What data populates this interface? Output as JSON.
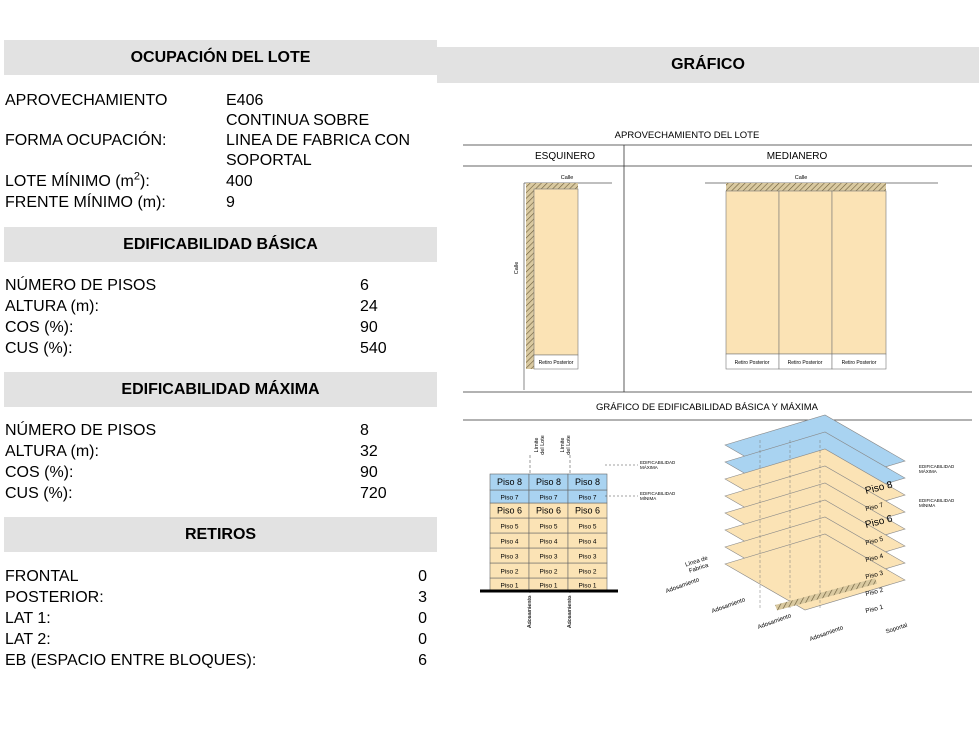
{
  "ocupacion": {
    "title": "OCUPACIÓN DEL LOTE",
    "aprovechamiento_label": "APROVECHAMIENTO",
    "aprovechamiento_value": "E406",
    "forma_label": "FORMA OCUPACIÓN:",
    "forma_value_1": "CONTINUA SOBRE",
    "forma_value_2": "LINEA DE FABRICA CON",
    "forma_value_3": "SOPORTAL",
    "lote_label": "LOTE MÍNIMO (m",
    "lote_sup": "2",
    "lote_label_end": "):",
    "lote_value": "400",
    "frente_label": "FRENTE MÍNIMO (m):",
    "frente_value": "9"
  },
  "basica": {
    "title": "EDIFICABILIDAD BÁSICA",
    "rows": [
      {
        "label": "NÚMERO DE PISOS",
        "value": "6"
      },
      {
        "label": "ALTURA (m):",
        "value": "24"
      },
      {
        "label": "COS (%):",
        "value": "90"
      },
      {
        "label": "CUS (%):",
        "value": "540"
      }
    ]
  },
  "maxima": {
    "title": "EDIFICABILIDAD MÁXIMA",
    "rows": [
      {
        "label": "NÚMERO DE PISOS",
        "value": "8"
      },
      {
        "label": "ALTURA (m):",
        "value": "32"
      },
      {
        "label": "COS (%):",
        "value": "90"
      },
      {
        "label": "CUS (%):",
        "value": "720"
      }
    ]
  },
  "retiros": {
    "title": "RETIROS",
    "rows": [
      {
        "label": "FRONTAL",
        "value": "0"
      },
      {
        "label": "POSTERIOR:",
        "value": "3"
      },
      {
        "label": "LAT 1:",
        "value": "0"
      },
      {
        "label": "LAT 2:",
        "value": "0"
      },
      {
        "label": "EB (ESPACIO ENTRE BLOQUES):",
        "value": "6"
      }
    ]
  },
  "grafico": {
    "title": "GRÁFICO",
    "aprov_title": "APROVECHAMIENTO DEL LOTE",
    "col_esquinero": "ESQUINERO",
    "col_medianero": "MEDIANERO",
    "calle": "Calle",
    "retiro_posterior": "Retiro Posterior",
    "edif_title": "GRÁFICO DE  EDIFICABILIDAD BÁSICA Y MÁXIMA",
    "limite_lote_1": "Límite",
    "limite_lote_2": "del Lote",
    "edif_maxima_1": "EDIFICABILIDAD",
    "edif_maxima_2": "MÁXIMA",
    "edif_minima_1": "EDIFICABILIDAD",
    "edif_minima_2": "MÍNIMA",
    "linea_fabrica_1": "Línea de",
    "linea_fabrica_2": "Fabrica",
    "adosamiento": "Adosamiento",
    "soportal": "Soportal",
    "pisos": [
      "Piso 1",
      "Piso 2",
      "Piso 3",
      "Piso 4",
      "Piso 5",
      "Piso 6",
      "Piso 7",
      "Piso 8"
    ]
  },
  "colors": {
    "header_bg": "#e2e2e2",
    "building_fill": "#fbe3b5",
    "max_floor_fill": "#a9d3f1",
    "hatch": "#8a7a55"
  }
}
